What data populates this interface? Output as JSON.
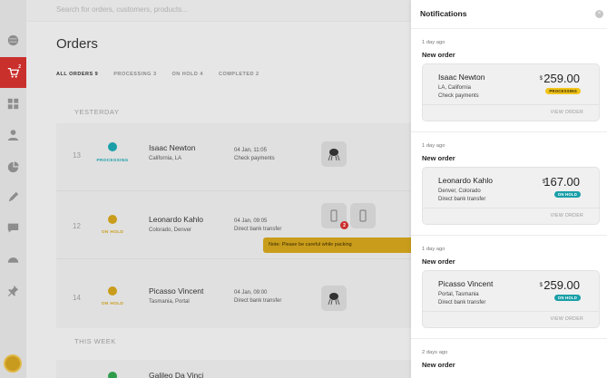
{
  "search": {
    "placeholder": "Search for orders, customers, products..."
  },
  "sidebar": {
    "cart_badge": "2"
  },
  "page": {
    "title": "Orders"
  },
  "tabs": [
    "ALL ORDERS 9",
    "PROCESSING 3",
    "ON HOLD 4",
    "COMPLETED 2"
  ],
  "sections": {
    "yesterday": "YESTERDAY",
    "this_week": "THIS WEEK"
  },
  "orders": [
    {
      "num": "13",
      "status": "PROCESSING",
      "status_color": "#1a9fa8",
      "name": "Isaac Newton",
      "location": "California, LA",
      "date": "04 Jan, 11:05",
      "payment": "Check payments"
    },
    {
      "num": "12",
      "status": "ON HOLD",
      "status_color": "#c99d1b",
      "name": "Leonardo Kahlo",
      "location": "Colorado, Denver",
      "date": "04 Jan, 09:05",
      "payment": "Direct bank transfer",
      "thumb_badge": "2",
      "note": "Note: Please be careful while packing"
    },
    {
      "num": "14",
      "status": "ON HOLD",
      "status_color": "#c99d1b",
      "name": "Picasso Vincent",
      "location": "Tasmania, Portal",
      "date": "04 Jan, 09:00",
      "payment": "Direct bank transfer"
    },
    {
      "name": "Galileo Da Vinci",
      "status_color": "#2e9b4a"
    }
  ],
  "notifications": {
    "title": "Notifications",
    "close": "×",
    "items": [
      {
        "when": "1 day ago",
        "title": "New order",
        "name": "Isaac Newton",
        "location": "LA, California",
        "payment": "Check payments",
        "currency": "$",
        "price": "259.00",
        "status": "PROCESSING",
        "status_bg": "#f0c419",
        "status_fg": "#3a2a00",
        "view": "VIEW ORDER"
      },
      {
        "when": "1 day ago",
        "title": "New order",
        "name": "Leonardo Kahlo",
        "location": "Denver, Colorado",
        "payment": "Direct bank transfer",
        "currency": "$",
        "price": "167.00",
        "status": "ON HOLD",
        "status_bg": "#1a9fa8",
        "status_fg": "#ffffff",
        "view": "VIEW ORDER"
      },
      {
        "when": "1 day ago",
        "title": "New order",
        "name": "Picasso Vincent",
        "location": "Portal, Tasmania",
        "payment": "Direct bank transfer",
        "currency": "$",
        "price": "259.00",
        "status": "ON HOLD",
        "status_bg": "#1a9fa8",
        "status_fg": "#ffffff",
        "view": "VIEW ORDER"
      },
      {
        "when": "2 days ago",
        "title": "New order"
      }
    ]
  }
}
